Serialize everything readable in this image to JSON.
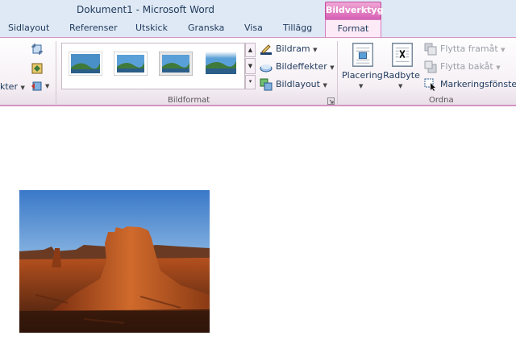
{
  "window": {
    "title": "Dokument1  -  Microsoft Word"
  },
  "context_tab": {
    "header": "Bildverktyg"
  },
  "tabs": [
    "Sidlayout",
    "Referenser",
    "Utskick",
    "Granska",
    "Visa",
    "Tillägg"
  ],
  "active_tab": "Format",
  "ribbon": {
    "left_partial_label": "kter",
    "groups": {
      "bildformat": {
        "label": "Bildformat",
        "commands": [
          "Bildram",
          "Bildeffekter",
          "Bildlayout"
        ]
      },
      "ordna": {
        "label": "Ordna",
        "placering": "Placering",
        "radbyte": "Radbyte",
        "flytta_framat": "Flytta framåt",
        "flytta_bakat": "Flytta bakåt",
        "markeringsfonster": "Markeringsfönster"
      }
    }
  },
  "colors": {
    "accent": "#d65fb3",
    "ribbon_border": "#d693c5",
    "text": "#1e395b"
  }
}
